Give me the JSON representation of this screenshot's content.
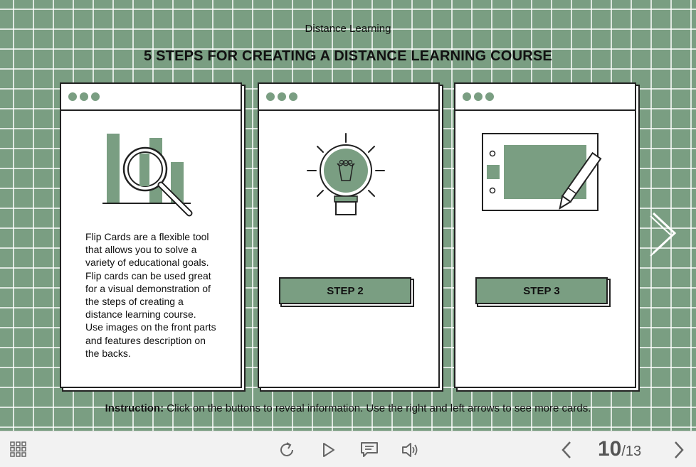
{
  "header": {
    "course": "Distance Learning",
    "title": "5 STEPS FOR CREATING A DISTANCE LEARNING COURSE"
  },
  "cards": [
    {
      "icon": "magnifier-chart-icon",
      "lines": [
        "Flip Cards are a flexible tool",
        "that allows you to solve a",
        "variety of educational goals.",
        "Flip cards can be used great",
        "for a visual demonstration of",
        "the steps of creating a",
        "distance learning course.",
        "Use images on the front parts",
        "and features description on",
        "the backs."
      ]
    },
    {
      "icon": "lightbulb-icon",
      "button": "STEP 2"
    },
    {
      "icon": "tablet-pen-icon",
      "button": "STEP 3"
    }
  ],
  "instruction": {
    "label": "Instruction:",
    "text": " Click on the buttons to reveal information. Use the right and left arrows to see more cards."
  },
  "player": {
    "current": "10",
    "total": "/13"
  },
  "colors": {
    "accent": "#7a9e82",
    "ink": "#222222",
    "toolbar": "#f2f2f2"
  }
}
